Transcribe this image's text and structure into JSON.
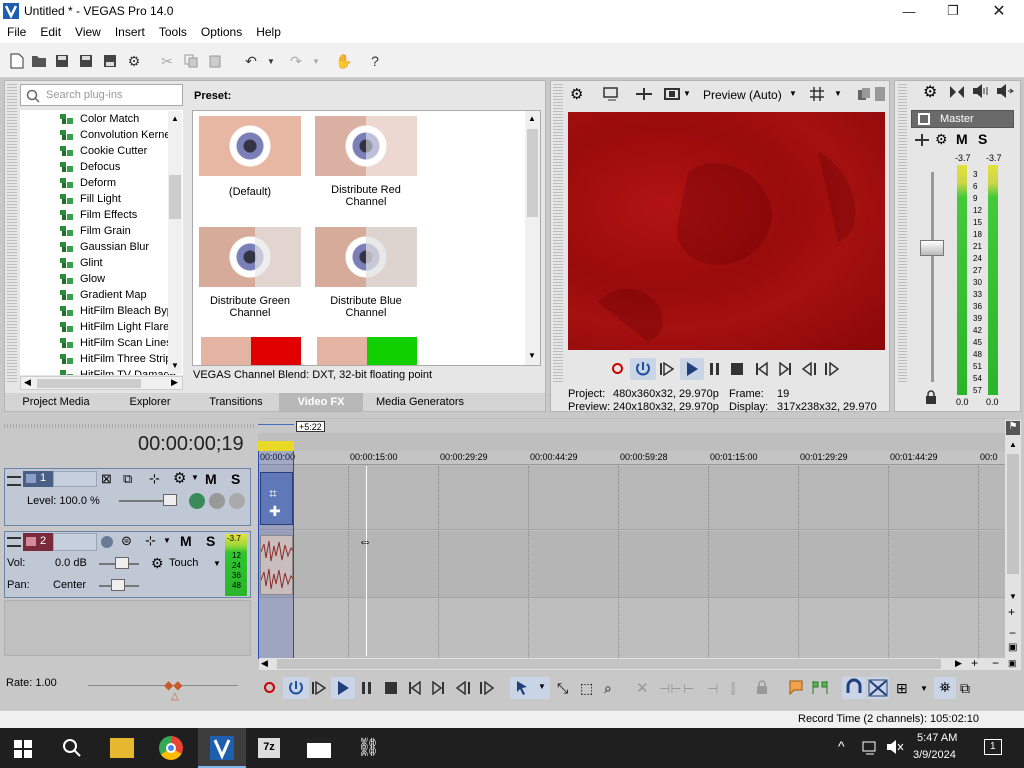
{
  "app": {
    "title": "Untitled * - VEGAS Pro 14.0"
  },
  "menu": [
    "File",
    "Edit",
    "View",
    "Insert",
    "Tools",
    "Options",
    "Help"
  ],
  "plugins": {
    "search_placeholder": "Search plug-ins",
    "items": [
      "Color Match",
      "Convolution Kerne",
      "Cookie Cutter",
      "Defocus",
      "Deform",
      "Fill Light",
      "Film Effects",
      "Film Grain",
      "Gaussian Blur",
      "Glint",
      "Glow",
      "Gradient Map",
      "HitFilm Bleach Byp",
      "HitFilm Light Flares",
      "HitFilm Scan Lines",
      "HitFilm Three Strip",
      "HitFilm TV Damage"
    ]
  },
  "presets": {
    "header": "Preset:",
    "items": [
      "(Default)",
      "Distribute Red Channel",
      "Distribute Green Channel",
      "Distribute Blue Channel"
    ],
    "status": "VEGAS Channel Blend: DXT, 32-bit floating point"
  },
  "bottom_tabs": [
    "Project Media",
    "Explorer",
    "Transitions",
    "Video FX",
    "Media Generators"
  ],
  "preview": {
    "mode": "Preview (Auto)",
    "project_label": "Project:",
    "project_value": "480x360x32, 29.970p",
    "preview_label": "Preview:",
    "preview_value": "240x180x32, 29.970p",
    "frame_label": "Frame:",
    "frame_value": "19",
    "display_label": "Display:",
    "display_value": "317x238x32, 29.970"
  },
  "master": {
    "label": "Master",
    "m": "M",
    "s": "S",
    "peak_left": "-3.7",
    "peak_right": "-3.7",
    "scale": [
      "3",
      "6",
      "9",
      "12",
      "15",
      "18",
      "21",
      "24",
      "27",
      "30",
      "33",
      "36",
      "39",
      "42",
      "45",
      "48",
      "51",
      "54",
      "57"
    ],
    "level_left": "0.0",
    "level_right": "0.0"
  },
  "timeline": {
    "time": "00:00:00;19",
    "offset_badge": "+5:22",
    "ruler": [
      "00:00:00",
      "00:00:15:00",
      "00:00:29:29",
      "00:00:44:29",
      "00:00:59:28",
      "00:01:15:00",
      "00:01:29:29",
      "00:01:44:29",
      "00:0"
    ],
    "rate": "Rate: 1.00",
    "record_time": "Record Time (2 channels): 105:02:10"
  },
  "track1": {
    "number": "1",
    "m": "M",
    "s": "S",
    "level": "Level: 100.0 %"
  },
  "track2": {
    "number": "2",
    "m": "M",
    "s": "S",
    "vol_label": "Vol:",
    "vol_value": "0.0 dB",
    "pan_label": "Pan:",
    "pan_value": "Center",
    "automation": "Touch",
    "meter_peak": "-3.7",
    "meter_marks": [
      "12",
      "24",
      "36",
      "48"
    ]
  },
  "taskbar": {
    "time": "5:47 AM",
    "date": "3/9/2024",
    "notify": "1"
  }
}
